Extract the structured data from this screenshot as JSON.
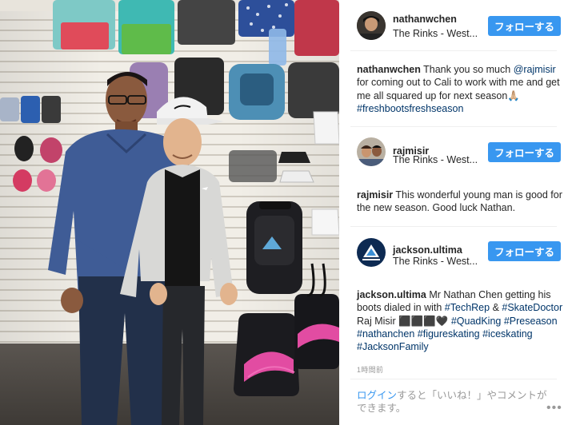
{
  "post_author": {
    "username": "nathanwchen",
    "location": "The Rinks - West...",
    "follow_label": "フォローする"
  },
  "caption": {
    "username": "nathanwchen",
    "text_1": " Thank you so much ",
    "mention": "@rajmisir",
    "text_2": " for coming out to Cali to work with me and get me all squared up for next season🙏🏼 ",
    "hashtag": "#freshbootsfreshseason"
  },
  "suggestions": [
    {
      "username": "rajmisir",
      "location": "The Rinks - West...",
      "follow_label": "フォローする",
      "comment_text": " This wonderful young man is good for the new season. Good luck Nathan."
    },
    {
      "username": "jackson.ultima",
      "location": "The Rinks - West...",
      "follow_label": "フォローする",
      "comment_parts": [
        {
          "t": " Mr Nathan Chen getting his boots dialed in with ",
          "tag": false
        },
        {
          "t": "#TechRep",
          "tag": true
        },
        {
          "t": " & ",
          "tag": false
        },
        {
          "t": "#SkateDoctor",
          "tag": true
        },
        {
          "t": " Raj Misir ⬛⬛⬛🖤 ",
          "tag": false
        },
        {
          "t": "#QuadKing",
          "tag": true
        },
        {
          "t": " ",
          "tag": false
        },
        {
          "t": "#Preseason",
          "tag": true
        },
        {
          "t": " ",
          "tag": false
        },
        {
          "t": "#nathanchen",
          "tag": true
        },
        {
          "t": " ",
          "tag": false
        },
        {
          "t": "#figureskating",
          "tag": true
        },
        {
          "t": " ",
          "tag": false
        },
        {
          "t": "#iceskating",
          "tag": true
        },
        {
          "t": " ",
          "tag": false
        },
        {
          "t": "#JacksonFamily",
          "tag": true
        }
      ]
    }
  ],
  "timestamp": "1時間前",
  "login_prompt": {
    "link": "ログイン",
    "text": "すると「いいね！」やコメントができます。"
  },
  "more_label": "•••",
  "colors": {
    "follow_button": "#3897f0",
    "hashtag": "#003569",
    "link": "#3897f0"
  }
}
